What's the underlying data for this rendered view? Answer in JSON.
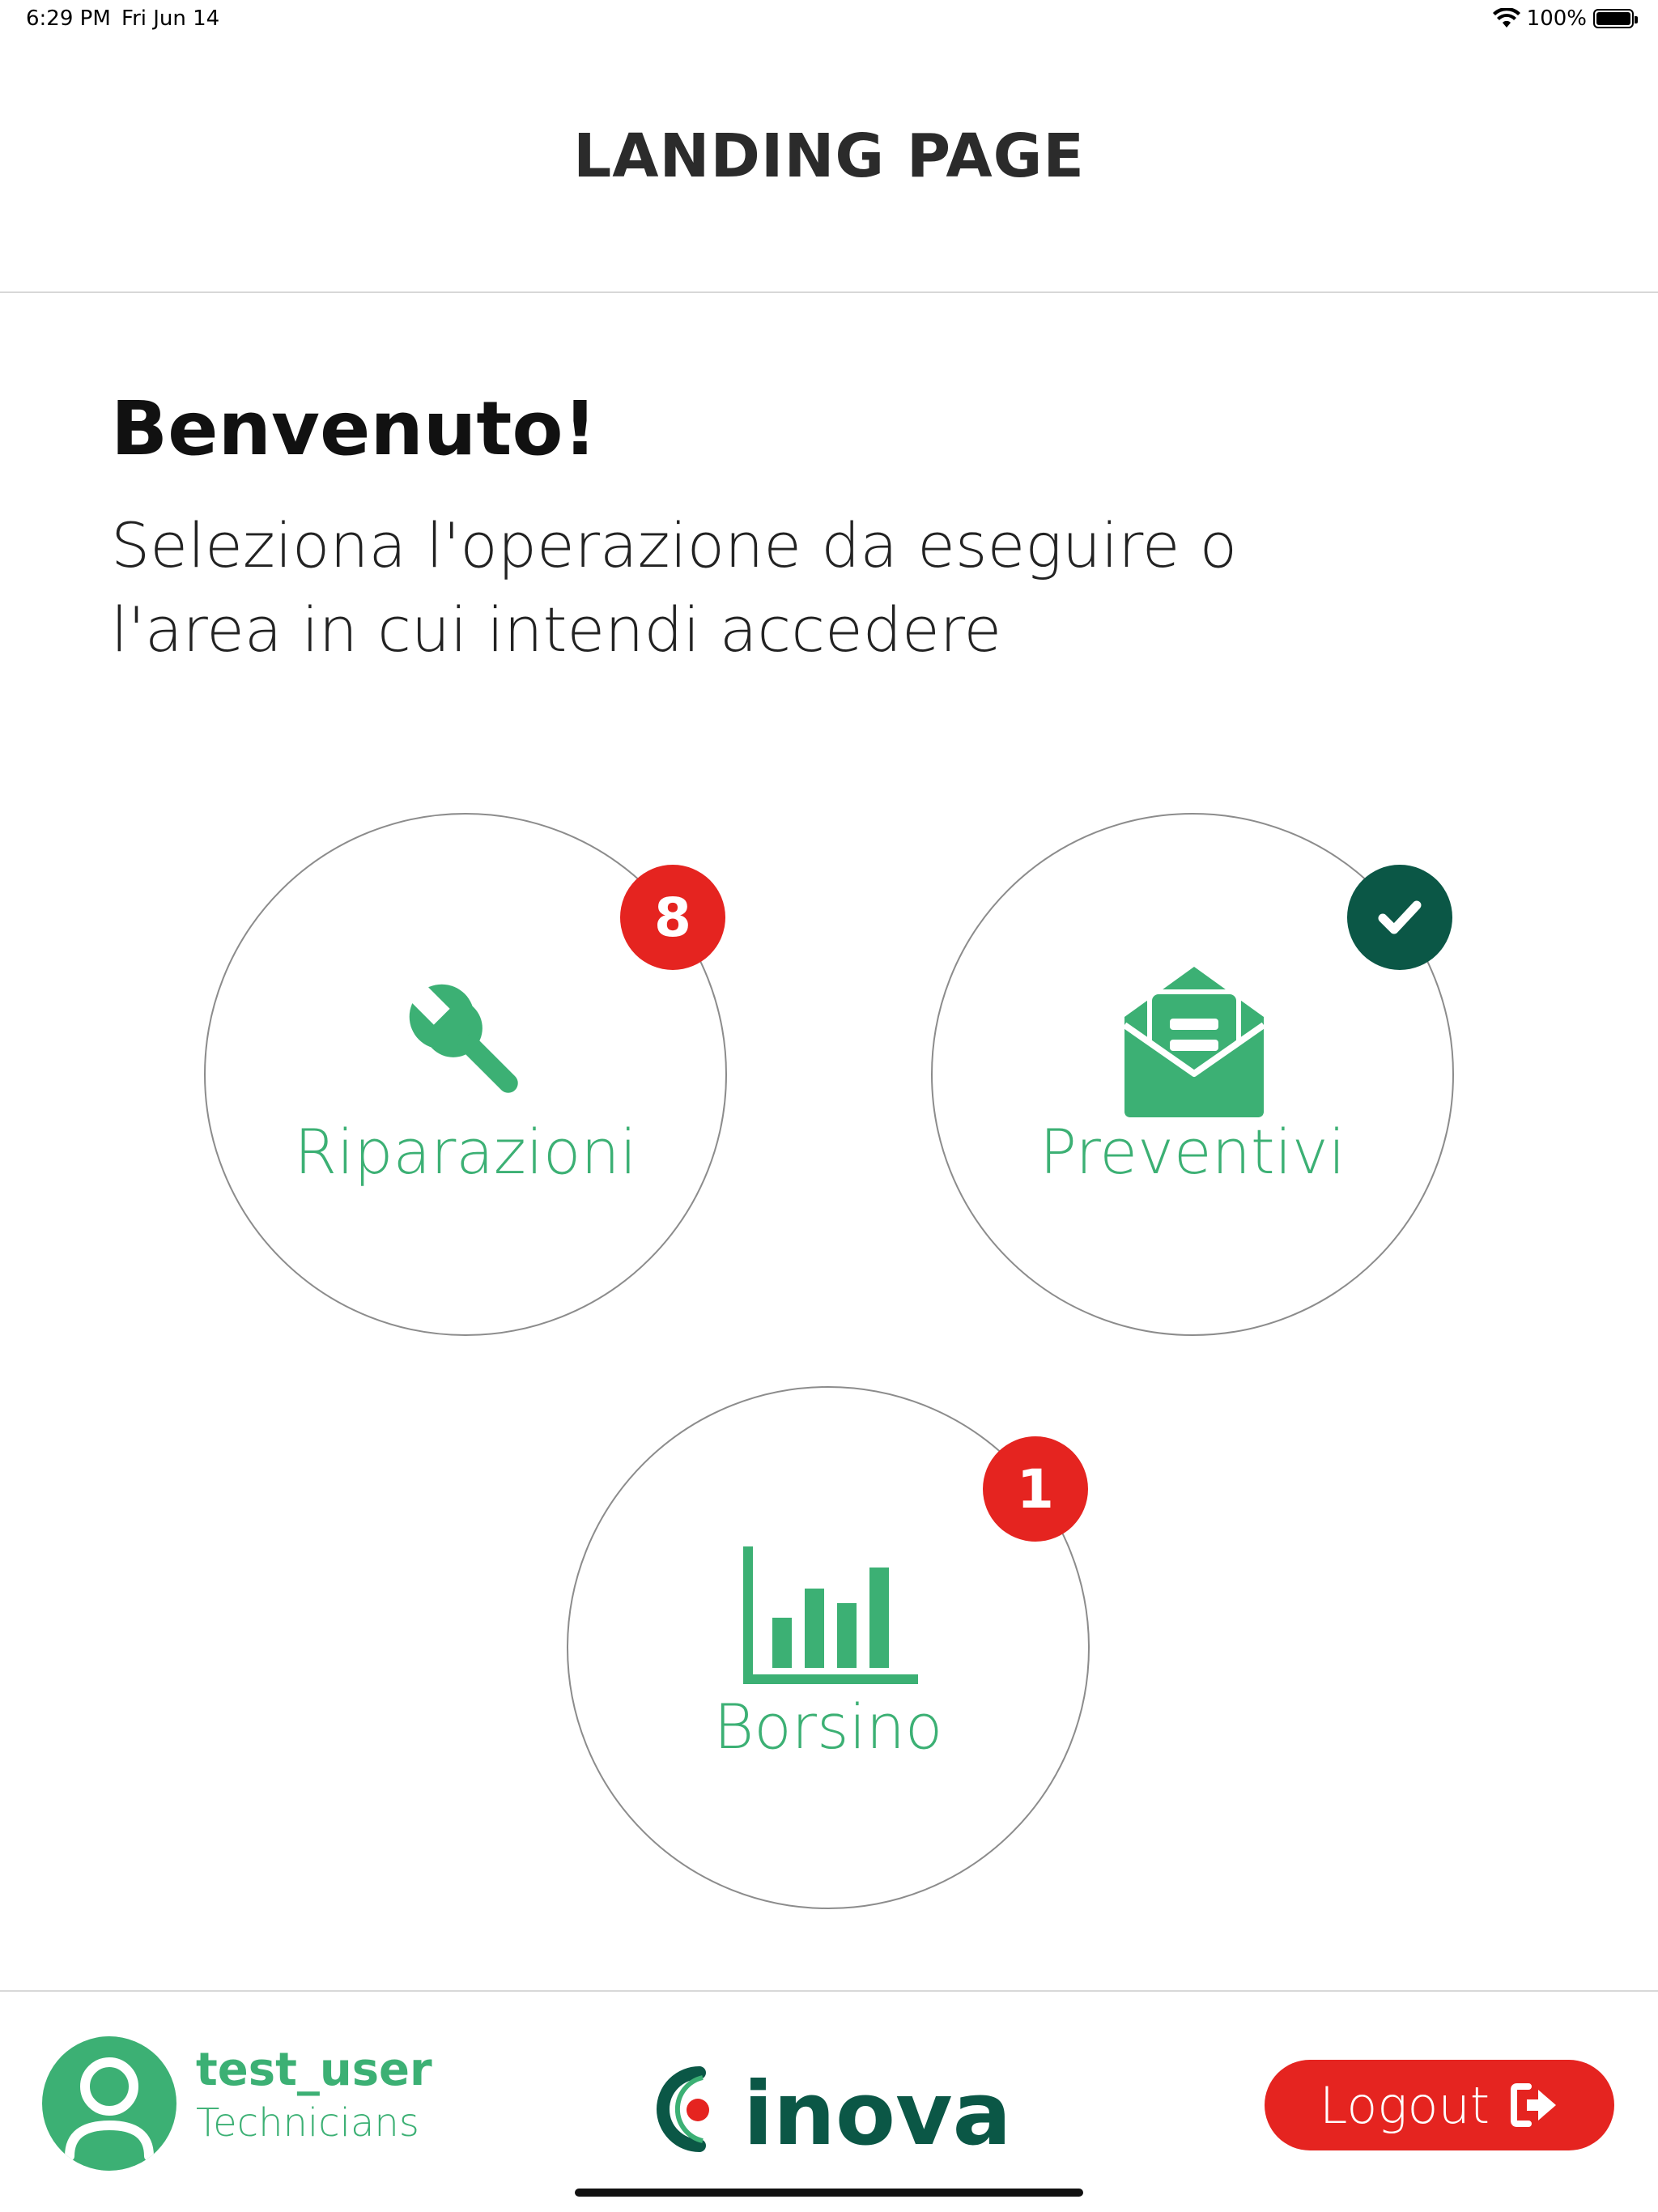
{
  "status_bar": {
    "time": "6:29 PM",
    "date": "Fri Jun 14",
    "battery": "100%",
    "wifi_icon": "wifi-icon",
    "battery_icon": "battery-icon"
  },
  "header": {
    "title": "LANDING PAGE"
  },
  "welcome": {
    "heading": "Benvenuto!",
    "subtitle": "Seleziona l'operazione da eseguire o l'area in cui intendi accedere"
  },
  "tiles": [
    {
      "label": "Riparazioni",
      "icon": "wrench-icon",
      "badge": "8",
      "badge_color": "#e52420"
    },
    {
      "label": "Preventivi",
      "icon": "open-envelope-icon",
      "badge": "check",
      "badge_color": "#0b5746"
    },
    {
      "label": "Borsino",
      "icon": "bar-chart-icon",
      "badge": "1",
      "badge_color": "#e52420"
    }
  ],
  "footer": {
    "username": "test_user",
    "role": "Technicians",
    "avatar_icon": "user-avatar-icon",
    "logo_text": "inova",
    "logout_label": "Logout",
    "logout_icon": "sign-out-icon"
  },
  "colors": {
    "accent_green": "#3cb074",
    "badge_red": "#e52420",
    "badge_dark_green": "#0b5746",
    "logout_red": "#e52420"
  }
}
